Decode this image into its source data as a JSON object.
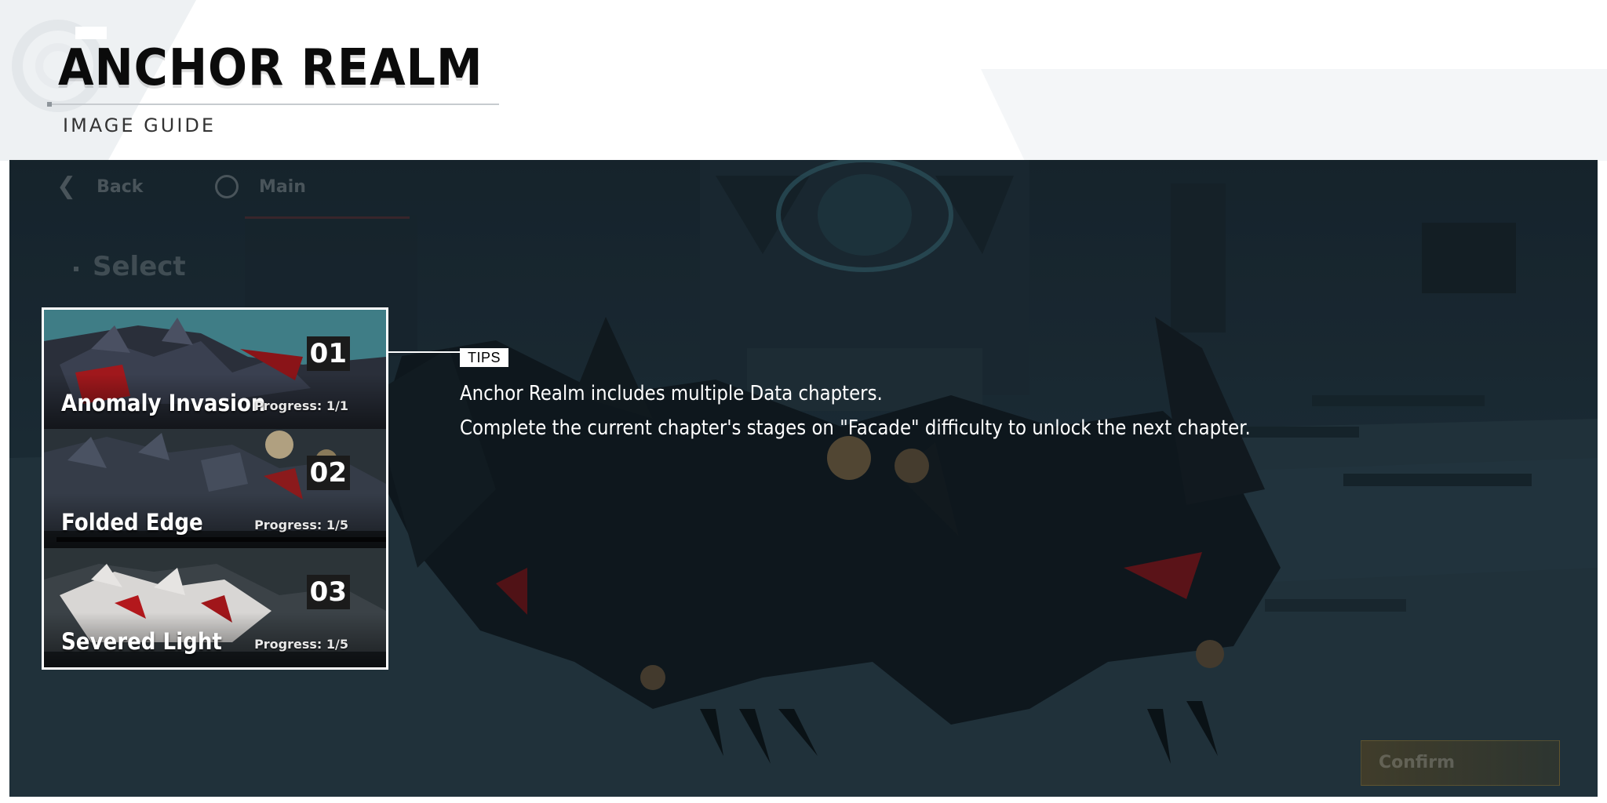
{
  "header": {
    "title": "ANCHOR REALM",
    "subtitle": "IMAGE GUIDE"
  },
  "nav": {
    "back_label": "Back",
    "main_label": "Main"
  },
  "select_label": "Select",
  "chapters": [
    {
      "number": "01",
      "name": "Anomaly Invasion",
      "progress": "Progress: 1/1"
    },
    {
      "number": "02",
      "name": "Folded Edge",
      "progress": "Progress: 1/5"
    },
    {
      "number": "03",
      "name": "Severed Light",
      "progress": "Progress: 1/5"
    }
  ],
  "tips": {
    "tag": "TIPS",
    "line1": "Anchor Realm includes multiple Data chapters.",
    "line2": "Complete the current chapter's stages on \"Facade\" difficulty to unlock the next chapter."
  },
  "confirm_label": "Confirm",
  "colors": {
    "scene_bg": "#22343e",
    "highlight_border": "#ffffff",
    "accent_red": "#b01e23"
  }
}
